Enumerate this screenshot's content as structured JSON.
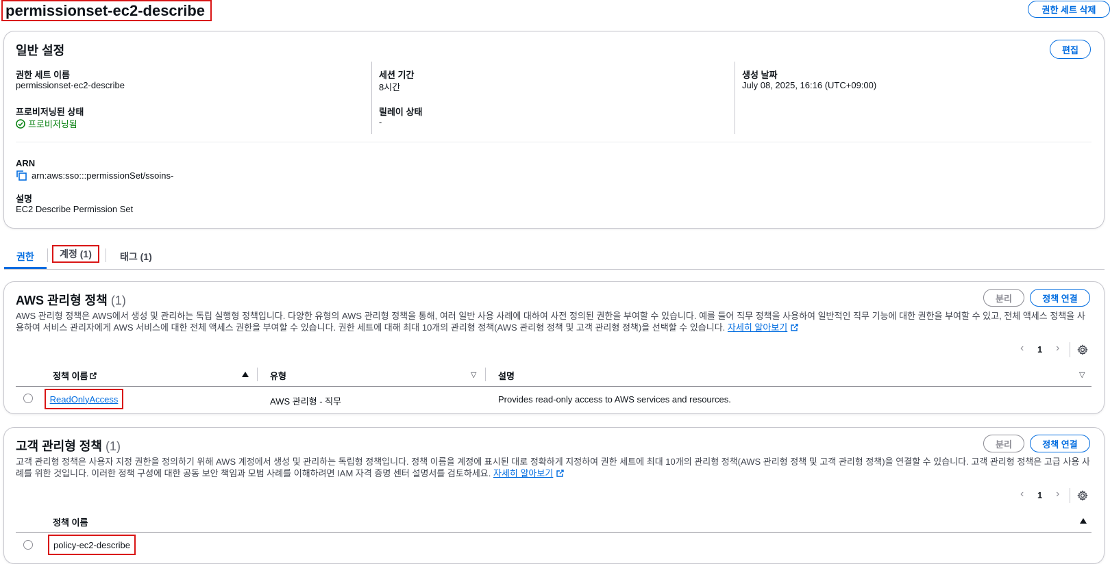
{
  "header": {
    "title": "permissionset-ec2-describe",
    "delete_button": "권한 세트 삭제"
  },
  "general": {
    "title": "일반 설정",
    "edit_button": "편집",
    "name_label": "권한 세트 이름",
    "name_value": "permissionset-ec2-describe",
    "session_label": "세션 기간",
    "session_value": "8시간",
    "created_label": "생성 날짜",
    "created_value": "July 08, 2025, 16:16 (UTC+09:00)",
    "provisioned_label": "프로비저닝된 상태",
    "provisioned_value": "프로비저닝됨",
    "relay_label": "릴레이 상태",
    "relay_value": "-",
    "arn_label": "ARN",
    "arn_value": "arn:aws:sso:::permissionSet/ssoins-",
    "desc_label": "설명",
    "desc_value": "EC2 Describe Permission Set"
  },
  "tabs": [
    {
      "label": "권한"
    },
    {
      "label": "계정 (1)"
    },
    {
      "label": "태그 (1)"
    }
  ],
  "aws_managed": {
    "title": "AWS 관리형 정책",
    "count": "(1)",
    "detach_button": "분리",
    "attach_button": "정책 연결",
    "description": "AWS 관리형 정책은 AWS에서 생성 및 관리하는 독립 실행형 정책입니다. 다양한 유형의 AWS 관리형 정책을 통해, 여러 일반 사용 사례에 대하여 사전 정의된 권한을 부여할 수 있습니다. 예를 들어 직무 정책을 사용하여 일반적인 직무 기능에 대한 권한을 부여할 수 있고, 전체 액세스 정책을 사용하여 서비스 관리자에게 AWS 서비스에 대한 전체 액세스 권한을 부여할 수 있습니다. 권한 세트에 대해 최대 10개의 관리형 정책(AWS 관리형 정책 및 고객 관리형 정책)을 선택할 수 있습니다.",
    "learn_more": "자세히 알아보기",
    "page": "1",
    "columns": [
      "정책 이름",
      "유형",
      "설명"
    ],
    "rows": [
      {
        "name": "ReadOnlyAccess",
        "type": "AWS 관리형 - 직무",
        "description": "Provides read-only access to AWS services and resources."
      }
    ]
  },
  "customer_managed": {
    "title": "고객 관리형 정책",
    "count": "(1)",
    "detach_button": "분리",
    "attach_button": "정책 연결",
    "description": "고객 관리형 정책은 사용자 지정 권한을 정의하기 위해 AWS 계정에서 생성 및 관리하는 독립형 정책입니다. 정책 이름을 계정에 표시된 대로 정확하게 지정하여 권한 세트에 최대 10개의 관리형 정책(AWS 관리형 정책 및 고객 관리형 정책)을 연결할 수 있습니다. 고객 관리형 정책은 고급 사용 사례를 위한 것입니다. 이러한 정책 구성에 대한 공동 보안 책임과 모범 사례를 이해하려면 IAM 자격 증명 센터 설명서를 검토하세요.",
    "learn_more": "자세히 알아보기",
    "page": "1",
    "columns": [
      "정책 이름"
    ],
    "rows": [
      {
        "name": "policy-ec2-describe"
      }
    ]
  },
  "colors": {
    "accent": "#006ce0",
    "highlight": "#d91515",
    "success": "#037f0c"
  }
}
